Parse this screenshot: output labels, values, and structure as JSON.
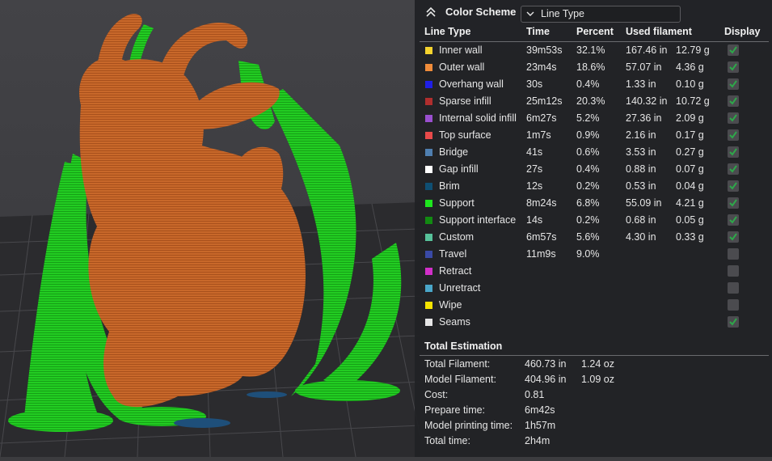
{
  "color_scheme": {
    "title": "Color Scheme",
    "selected": "Line Type"
  },
  "table": {
    "headers": {
      "line_type": "Line Type",
      "time": "Time",
      "percent": "Percent",
      "used_filament": "Used filament",
      "display": "Display"
    },
    "rows": [
      {
        "name": "Inner wall",
        "color": "#f5d32e",
        "time": "39m53s",
        "percent": "32.1%",
        "length": "167.46 in",
        "weight": "12.79 g",
        "display": true
      },
      {
        "name": "Outer wall",
        "color": "#f08c3a",
        "time": "23m4s",
        "percent": "18.6%",
        "length": "57.07 in",
        "weight": "4.36 g",
        "display": true
      },
      {
        "name": "Overhang wall",
        "color": "#1f1fe6",
        "time": "30s",
        "percent": "0.4%",
        "length": "1.33 in",
        "weight": "0.10 g",
        "display": true
      },
      {
        "name": "Sparse infill",
        "color": "#b02e2e",
        "time": "25m12s",
        "percent": "20.3%",
        "length": "140.32 in",
        "weight": "10.72 g",
        "display": true
      },
      {
        "name": "Internal solid infill",
        "color": "#9a4fcf",
        "time": "6m27s",
        "percent": "5.2%",
        "length": "27.36 in",
        "weight": "2.09 g",
        "display": true
      },
      {
        "name": "Top surface",
        "color": "#e84a4a",
        "time": "1m7s",
        "percent": "0.9%",
        "length": "2.16 in",
        "weight": "0.17 g",
        "display": true
      },
      {
        "name": "Bridge",
        "color": "#4f7fb0",
        "time": "41s",
        "percent": "0.6%",
        "length": "3.53 in",
        "weight": "0.27 g",
        "display": true
      },
      {
        "name": "Gap infill",
        "color": "#ffffff",
        "time": "27s",
        "percent": "0.4%",
        "length": "0.88 in",
        "weight": "0.07 g",
        "display": true
      },
      {
        "name": "Brim",
        "color": "#0f4f73",
        "time": "12s",
        "percent": "0.2%",
        "length": "0.53 in",
        "weight": "0.04 g",
        "display": true
      },
      {
        "name": "Support",
        "color": "#1ee61e",
        "time": "8m24s",
        "percent": "6.8%",
        "length": "55.09 in",
        "weight": "4.21 g",
        "display": true
      },
      {
        "name": "Support interface",
        "color": "#128a12",
        "time": "14s",
        "percent": "0.2%",
        "length": "0.68 in",
        "weight": "0.05 g",
        "display": true
      },
      {
        "name": "Custom",
        "color": "#57c29a",
        "time": "6m57s",
        "percent": "5.6%",
        "length": "4.30 in",
        "weight": "0.33 g",
        "display": true
      },
      {
        "name": "Travel",
        "color": "#3a4aa6",
        "time": "11m9s",
        "percent": "9.0%",
        "length": "",
        "weight": "",
        "display": false
      },
      {
        "name": "Retract",
        "color": "#d22fc9",
        "time": "",
        "percent": "",
        "length": "",
        "weight": "",
        "display": false
      },
      {
        "name": "Unretract",
        "color": "#4aa6c9",
        "time": "",
        "percent": "",
        "length": "",
        "weight": "",
        "display": false
      },
      {
        "name": "Wipe",
        "color": "#f5e400",
        "time": "",
        "percent": "",
        "length": "",
        "weight": "",
        "display": false
      },
      {
        "name": "Seams",
        "color": "#e6e6e6",
        "time": "",
        "percent": "",
        "length": "",
        "weight": "",
        "display": true
      }
    ]
  },
  "estimation": {
    "title": "Total Estimation",
    "rows": [
      {
        "label": "Total Filament:",
        "v1": "460.73 in",
        "v2": "1.24 oz"
      },
      {
        "label": "Model Filament:",
        "v1": "404.96 in",
        "v2": "1.09 oz"
      },
      {
        "label": "Cost:",
        "v1": "0.81",
        "v2": ""
      },
      {
        "label": "Prepare time:",
        "v1": "6m42s",
        "v2": ""
      },
      {
        "label": "Model printing time:",
        "v1": "1h57m",
        "v2": ""
      },
      {
        "label": "Total time:",
        "v1": "2h4m",
        "v2": ""
      }
    ]
  },
  "colors": {
    "panel_bg": "#212225",
    "checkbox_check": "#2ea84a",
    "model_orange": "#c8682a",
    "support_green": "#22cc22",
    "plate": "#2b2b2e"
  }
}
